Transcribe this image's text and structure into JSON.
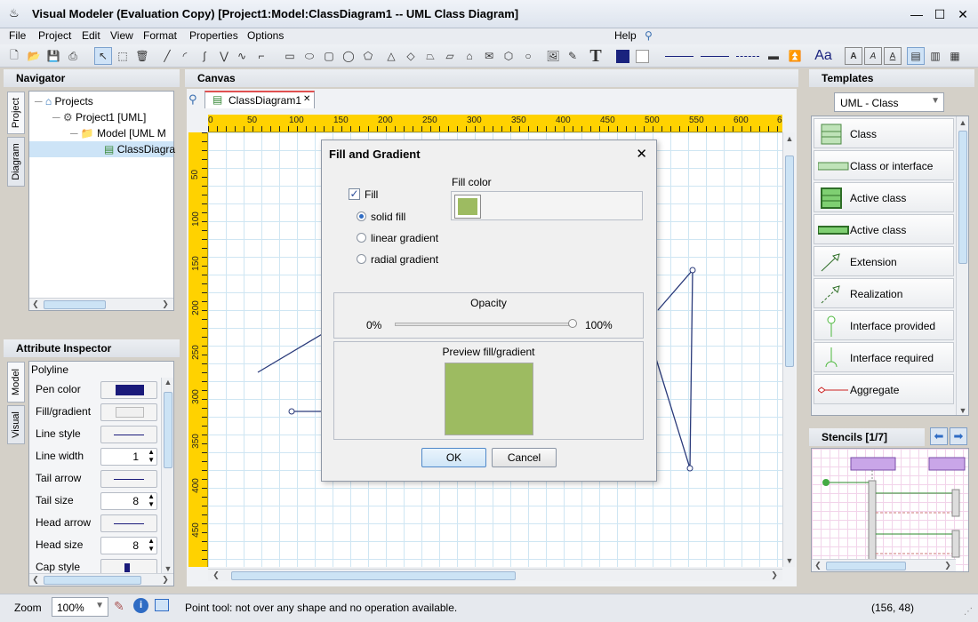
{
  "window": {
    "title": "Visual Modeler  (Evaluation Copy) [Project1:Model:ClassDiagram1 -- UML Class Diagram]",
    "minimize": "—",
    "maximize": "☐",
    "close": "✕"
  },
  "menu": {
    "file": "File",
    "project": "Project",
    "edit": "Edit",
    "view": "View",
    "format": "Format",
    "properties": "Properties",
    "options": "Options",
    "help": "Help"
  },
  "toolbar": {
    "text_tool": "T",
    "font_tool": "Aa",
    "accent_color": "#1a237e"
  },
  "navigator": {
    "title": "Navigator",
    "tabs": [
      "Project",
      "Diagram"
    ],
    "tree": [
      {
        "label": "Projects"
      },
      {
        "label": "Project1 [UML]"
      },
      {
        "label": "Model [UML M"
      },
      {
        "label": "ClassDiagra"
      }
    ]
  },
  "attributes": {
    "title": "Attribute Inspector",
    "tabs": [
      "Model",
      "Visual"
    ],
    "object": "Polyline",
    "rows": [
      {
        "label": "Pen color"
      },
      {
        "label": "Fill/gradient"
      },
      {
        "label": "Line style"
      },
      {
        "label": "Line width",
        "value": "1"
      },
      {
        "label": "Tail arrow"
      },
      {
        "label": "Tail size",
        "value": "8"
      },
      {
        "label": "Head arrow"
      },
      {
        "label": "Head size",
        "value": "8"
      },
      {
        "label": "Cap style"
      }
    ],
    "pen_color": "#1a1a7a"
  },
  "canvas": {
    "title": "Canvas",
    "tab": "ClassDiagram1",
    "tab_close": "✕",
    "ruler_top": [
      "0",
      "50",
      "100",
      "150",
      "200",
      "250",
      "300",
      "350",
      "400",
      "450",
      "500",
      "550",
      "600",
      "6"
    ],
    "ruler_left": [
      "50",
      "100",
      "150",
      "200",
      "250",
      "300",
      "350",
      "400",
      "450"
    ]
  },
  "dialog": {
    "title": "Fill and Gradient",
    "close": "✕",
    "fill_label": "Fill",
    "fill_checked": true,
    "fill_color_label": "Fill color",
    "fill_color": "#9dbb61",
    "options": [
      "solid fill",
      "linear gradient",
      "radial gradient"
    ],
    "selected_option": "solid fill",
    "opacity_label": "Opacity",
    "opacity_min": "0%",
    "opacity_max": "100%",
    "opacity_value": 1.0,
    "preview_label": "Preview fill/gradient",
    "ok": "OK",
    "cancel": "Cancel"
  },
  "templates": {
    "title": "Templates",
    "selector": "UML - Class",
    "items": [
      {
        "label": "Class"
      },
      {
        "label": "Class or interface"
      },
      {
        "label": "Active class"
      },
      {
        "label": "Active class"
      },
      {
        "label": "Extension"
      },
      {
        "label": "Realization"
      },
      {
        "label": "Interface provided"
      },
      {
        "label": "Interface required"
      },
      {
        "label": "Aggregate"
      }
    ]
  },
  "stencils": {
    "title": "Stencils [1/7]"
  },
  "status": {
    "zoom_label": "Zoom",
    "zoom_value": "100%",
    "message": "Point tool: not over any shape and no operation available.",
    "coords": "(156, 48)"
  }
}
